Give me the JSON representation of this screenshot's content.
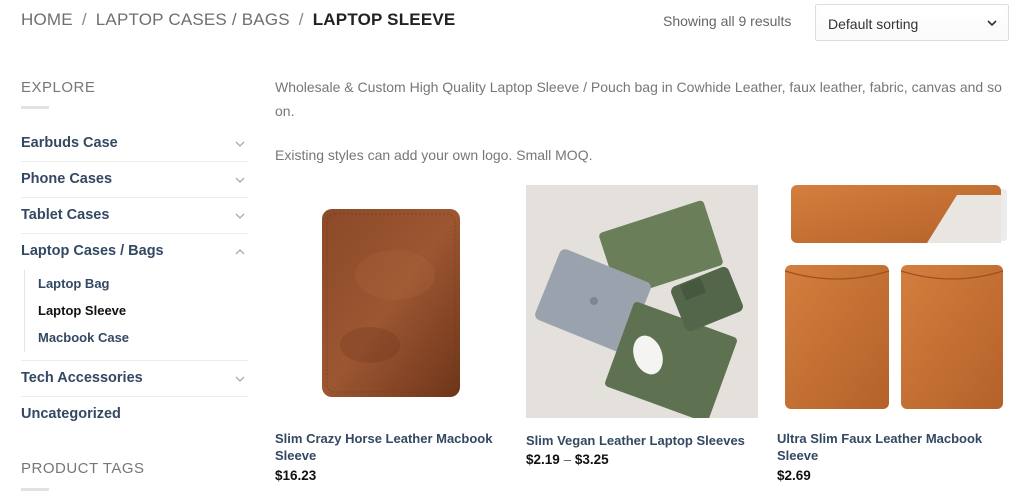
{
  "breadcrumb": {
    "home": "HOME",
    "parent": "LAPTOP CASES / BAGS",
    "current": "LAPTOP SLEEVE",
    "separator": "/"
  },
  "toolbar": {
    "result_count": "Showing all 9 results",
    "sort_selected": "Default sorting"
  },
  "sidebar": {
    "explore_title": "EXPLORE",
    "categories": [
      {
        "label": "Earbuds Case"
      },
      {
        "label": "Phone Cases"
      },
      {
        "label": "Tablet Cases"
      },
      {
        "label": "Laptop Cases / Bags"
      },
      {
        "label": "Tech Accessories"
      },
      {
        "label": "Uncategorized"
      }
    ],
    "subcategories": [
      {
        "label": "Laptop Bag"
      },
      {
        "label": "Laptop Sleeve"
      },
      {
        "label": "Macbook Case"
      }
    ],
    "tags_title": "PRODUCT TAGS"
  },
  "description": {
    "line1": "Wholesale & Custom High Quality Laptop Sleeve / Pouch bag in Cowhide Leather, faux leather, fabric, canvas and so on.",
    "line2": "Existing styles can add your own logo. Small MOQ."
  },
  "products": [
    {
      "name": "Slim Crazy Horse Leather Macbook Sleeve",
      "price": "$16.23"
    },
    {
      "name": "Slim Vegan Leather Laptop Sleeves",
      "price_low": "$2.19",
      "price_sep": "–",
      "price_high": "$3.25"
    },
    {
      "name": "Ultra Slim Faux Leather Macbook Sleeve",
      "price": "$2.69"
    }
  ],
  "colors": {
    "link": "#334862",
    "leather_brown": "#8a4a28",
    "leather_tan": "#c47335",
    "olive_green": "#5f7352"
  }
}
